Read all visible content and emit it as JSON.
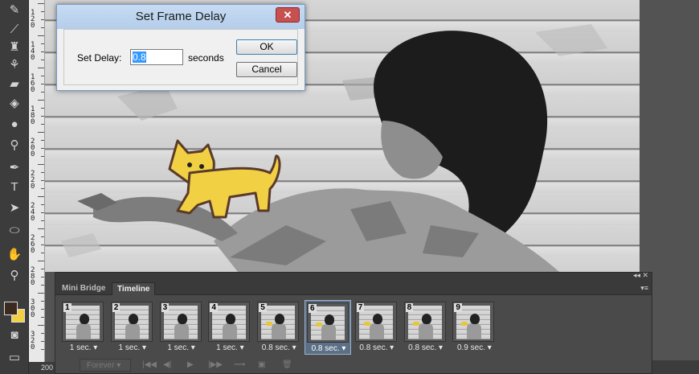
{
  "dialog": {
    "title": "Set Frame Delay",
    "close_glyph": "✕",
    "label": "Set Delay:",
    "value": "0.8",
    "units": "seconds",
    "ok": "OK",
    "cancel": "Cancel"
  },
  "panel": {
    "tabs": [
      "Mini Bridge",
      "Timeline"
    ],
    "active_tab": "Timeline",
    "collapse_glyph": "◂◂",
    "close_glyph": "✕",
    "menu_glyph": "▾≡",
    "frames": [
      {
        "num": "1",
        "delay": "1 sec."
      },
      {
        "num": "2",
        "delay": "1 sec."
      },
      {
        "num": "3",
        "delay": "1 sec."
      },
      {
        "num": "4",
        "delay": "1 sec."
      },
      {
        "num": "5",
        "delay": "0.8 sec."
      },
      {
        "num": "6",
        "delay": "0.8 sec."
      },
      {
        "num": "7",
        "delay": "0.8 sec."
      },
      {
        "num": "8",
        "delay": "0.8 sec."
      },
      {
        "num": "9",
        "delay": "0.9 sec."
      }
    ],
    "selected_frame": "6",
    "loop": "Forever",
    "controls": [
      "|◀◀",
      "◀|",
      "▶",
      "|▶▶",
      "tween-icon",
      "new-frame-icon",
      "delete-icon"
    ]
  },
  "ruler": {
    "labels": [
      "1\n2\n0",
      "1\n4\n0",
      "1\n6\n0",
      "1\n8\n0",
      "2\n0\n0",
      "2\n2\n0",
      "2\n4\n0",
      "2\n6\n0",
      "2\n8\n0",
      "3\n0\n0",
      "3\n2\n0"
    ]
  },
  "status": {
    "zoom": "200"
  },
  "colors": {
    "foreground": "#3b2a1f",
    "background": "#f1d044",
    "selection_blue": "#3399ff"
  }
}
